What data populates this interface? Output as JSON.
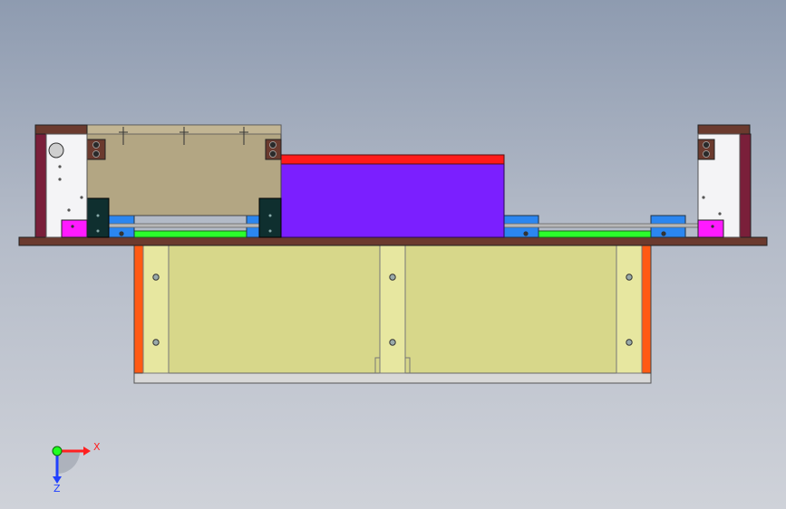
{
  "viewport": {
    "background_top": "#8e9bb0",
    "background_bottom": "#cfd2d9"
  },
  "colors": {
    "frame_brown": "#6b3a2e",
    "side_plate_maroon": "#7a1f3a",
    "plate_white": "#f4f4f6",
    "tan_block": "#b3a683",
    "purple_block": "#7b1fff",
    "red_top": "#ff1a1a",
    "blue_slider": "#2b86f0",
    "green_rail": "#2bff2b",
    "magenta_block": "#ff1aff",
    "dark_clamp": "#0f2f2f",
    "base_plate": "#d7d78a",
    "post_yellow": "#e7e7a0",
    "orange_side": "#ff5a14",
    "bottom_gray": "#d8d8d8",
    "rod_gray": "#b8b8b8"
  },
  "triad": {
    "x_label": "X",
    "z_label": "Z",
    "x_color": "#ff2020",
    "z_color": "#2040ff",
    "y_color": "#20ff20"
  }
}
